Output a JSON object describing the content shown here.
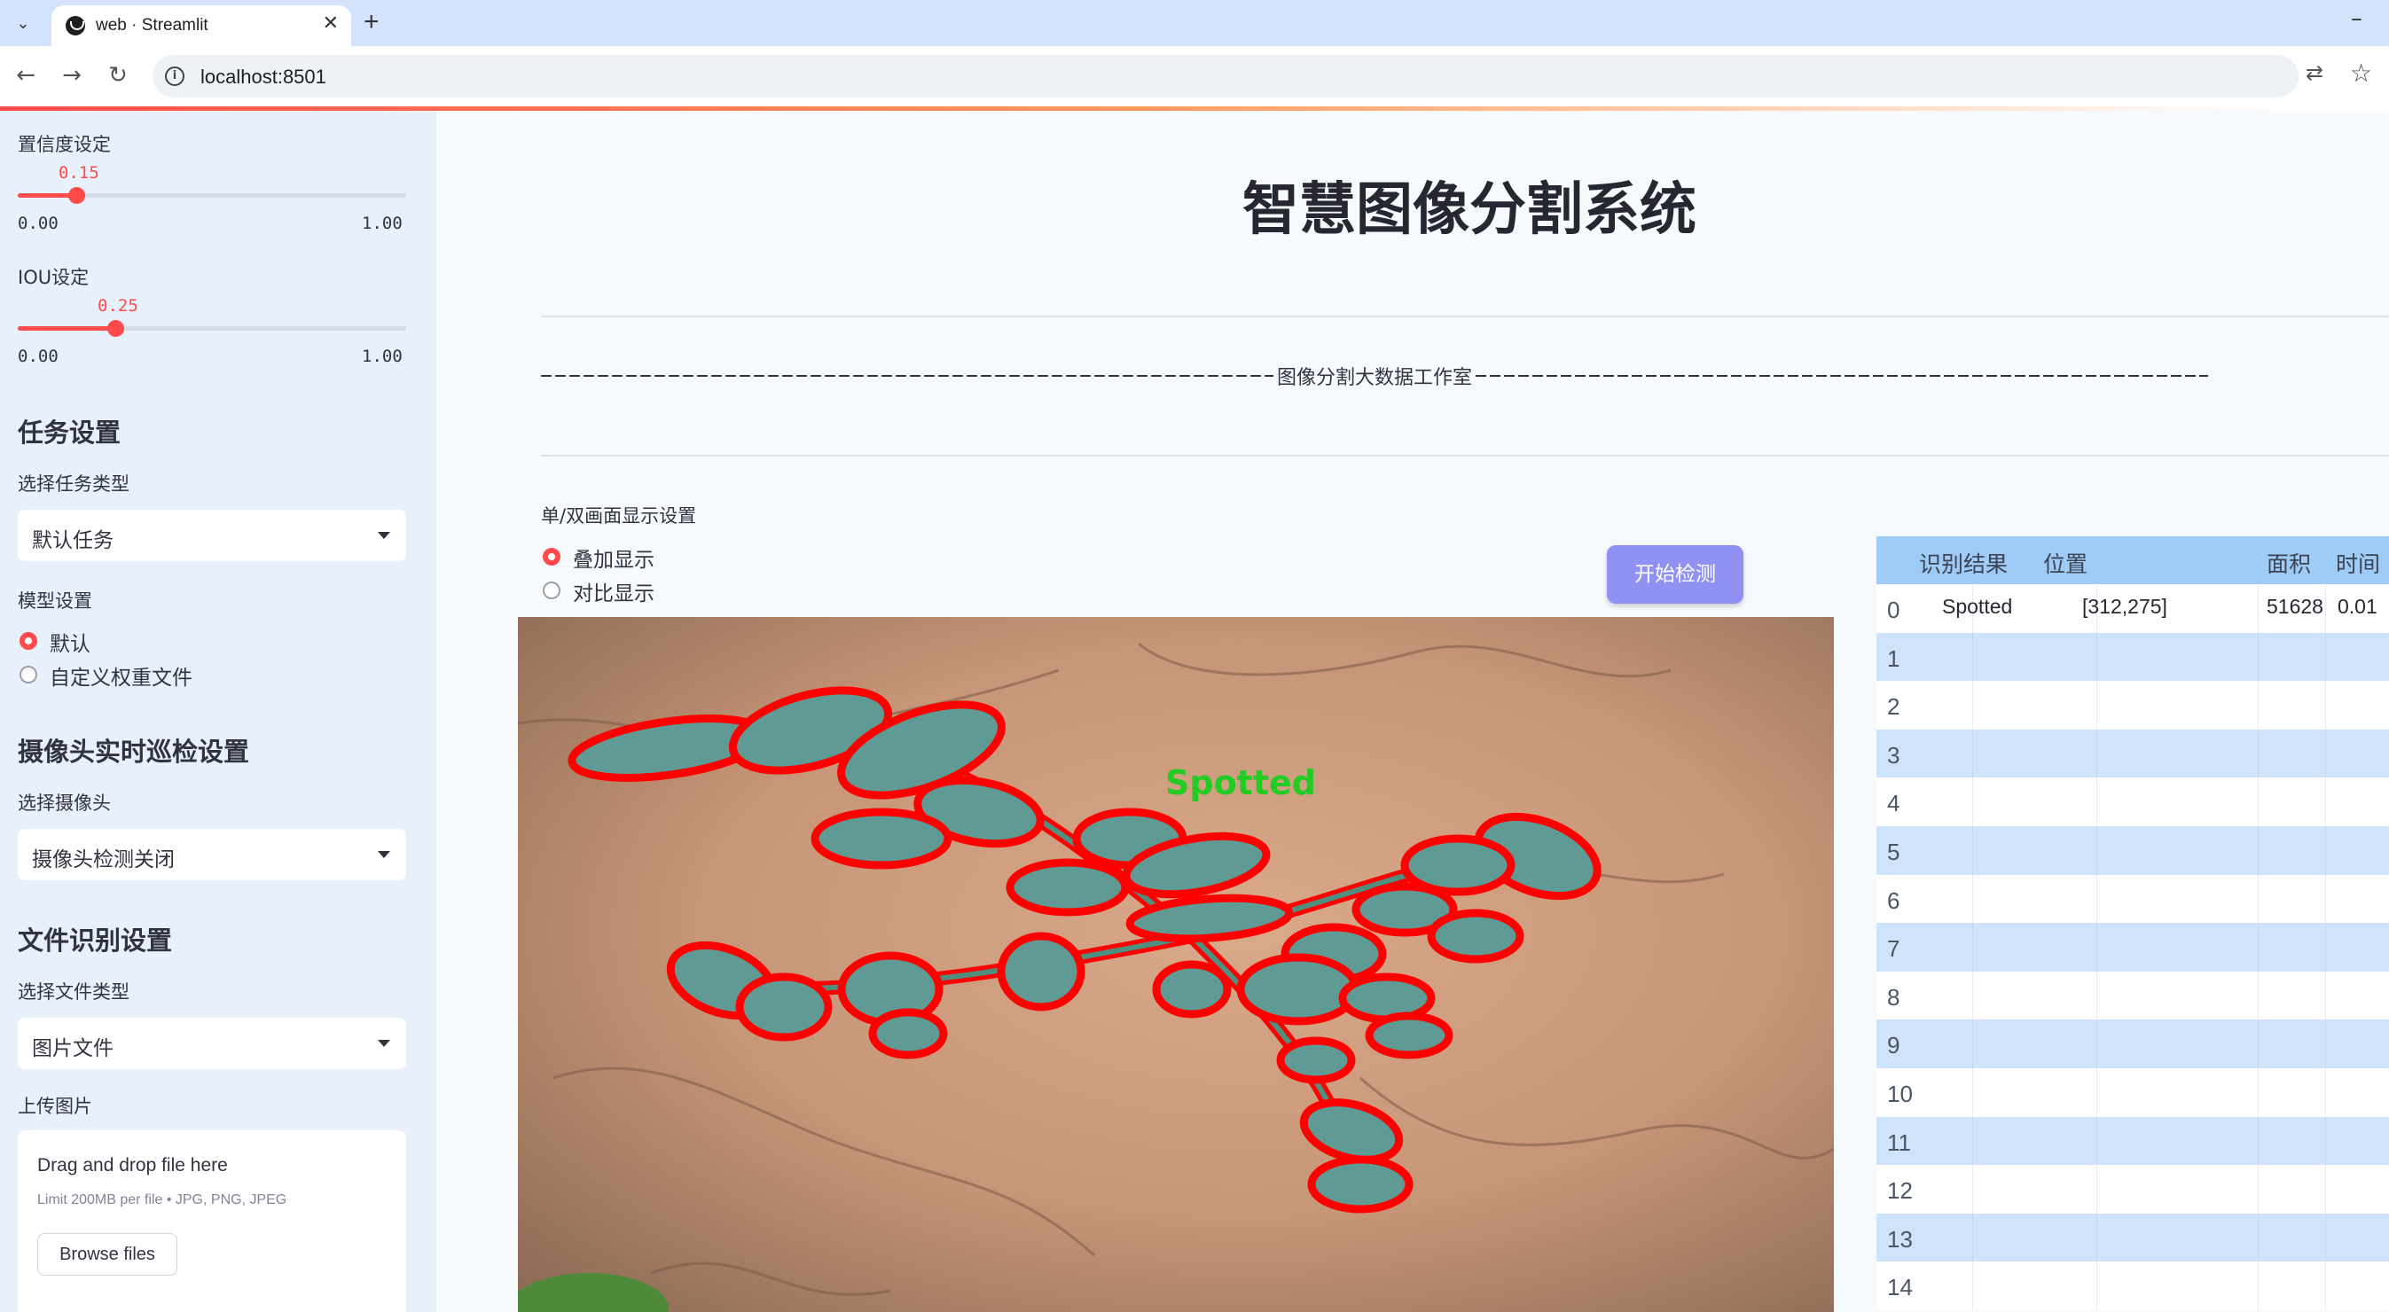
{
  "browser": {
    "tab_title": "web · Streamlit",
    "url": "localhost:8501"
  },
  "sidebar": {
    "confidence": {
      "label": "置信度设定",
      "value": "0.15",
      "min": "0.00",
      "max": "1.00",
      "level": 0.15
    },
    "iou": {
      "label": "IOU设定",
      "value": "0.25",
      "min": "0.00",
      "max": "1.00",
      "level": 0.25
    },
    "task_section": {
      "heading": "任务设置",
      "select_label": "选择任务类型",
      "selected": "默认任务"
    },
    "model_section": {
      "label": "模型设置",
      "options": [
        "默认",
        "自定义权重文件"
      ],
      "selected_index": 0
    },
    "camera_section": {
      "heading": "摄像头实时巡检设置",
      "select_label": "选择摄像头",
      "selected": "摄像头检测关闭"
    },
    "file_section": {
      "heading": "文件识别设置",
      "select_label": "选择文件类型",
      "selected": "图片文件"
    },
    "upload": {
      "label": "上传图片",
      "title": "Drag and drop file here",
      "subtitle": "Limit 200MB per file • JPG, PNG, JPEG",
      "button": "Browse files"
    }
  },
  "main": {
    "title": "智慧图像分割系统",
    "divider_text": "图像分割大数据工作室",
    "display_label": "单/双画面显示设置",
    "display_options": [
      "叠加显示",
      "对比显示"
    ],
    "display_selected_index": 0,
    "start_button": "开始检测",
    "detection_label": "Spotted"
  },
  "table": {
    "headers": [
      "识别结果",
      "位置",
      "面积",
      "时间"
    ],
    "rows": [
      {
        "idx": "0",
        "result": "Spotted",
        "position": "[312,275]",
        "area": "51628",
        "time": "0.01"
      },
      {
        "idx": "1"
      },
      {
        "idx": "2"
      },
      {
        "idx": "3"
      },
      {
        "idx": "4"
      },
      {
        "idx": "5"
      },
      {
        "idx": "6"
      },
      {
        "idx": "7"
      },
      {
        "idx": "8"
      },
      {
        "idx": "9"
      },
      {
        "idx": "10"
      },
      {
        "idx": "11"
      },
      {
        "idx": "12"
      },
      {
        "idx": "13"
      },
      {
        "idx": "14"
      }
    ]
  },
  "colors": {
    "accent": "#ff4b4b",
    "button": "#8f92f3",
    "sidebar_bg": "#e8f0fb",
    "table_header": "#9fcbf7",
    "table_stripe": "#cfe3fa",
    "mask_outline": "#ff0000",
    "label_text": "#22cc22"
  },
  "icons": [
    "tab-dropdown-icon",
    "streamlit-favicon",
    "close-icon",
    "plus-icon",
    "minimize-icon",
    "back-arrow-icon",
    "forward-arrow-icon",
    "reload-icon",
    "site-info-icon",
    "translate-icon",
    "star-icon",
    "chevron-down-icon"
  ]
}
